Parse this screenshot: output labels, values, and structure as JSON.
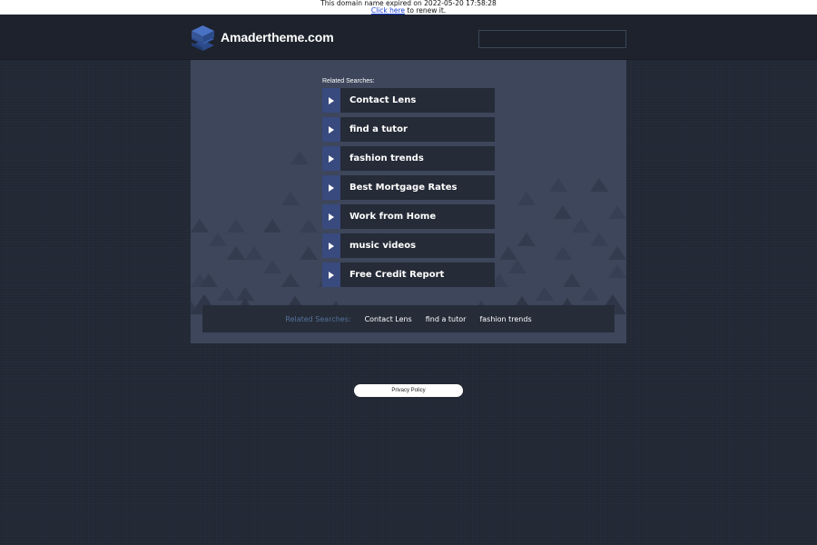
{
  "notice": {
    "expired_text": "This domain name expired on 2022-05-20 17:58:28",
    "renew_link": "Click here",
    "renew_suffix": " to renew it."
  },
  "header": {
    "site_name": "Amadertheme.com",
    "search_value": ""
  },
  "related": {
    "title": "Related Searches:",
    "items": [
      {
        "label": "Contact Lens"
      },
      {
        "label": "find a tutor"
      },
      {
        "label": "fashion trends"
      },
      {
        "label": "Best Mortgage Rates"
      },
      {
        "label": "Work from Home"
      },
      {
        "label": "music videos"
      },
      {
        "label": "Free Credit Report"
      }
    ]
  },
  "bottom_bar": {
    "title": "Related Searches:",
    "links": [
      "Contact Lens",
      "find a tutor",
      "fashion trends"
    ]
  },
  "footer": {
    "privacy_label": "Privacy Policy"
  },
  "colors": {
    "page_bg": "#232936",
    "header_bg": "#1d222c",
    "panel_bg": "#3d465b",
    "link_bg": "#252b37",
    "arrow_box": "#394a7e",
    "bottom_title": "#56709a"
  }
}
